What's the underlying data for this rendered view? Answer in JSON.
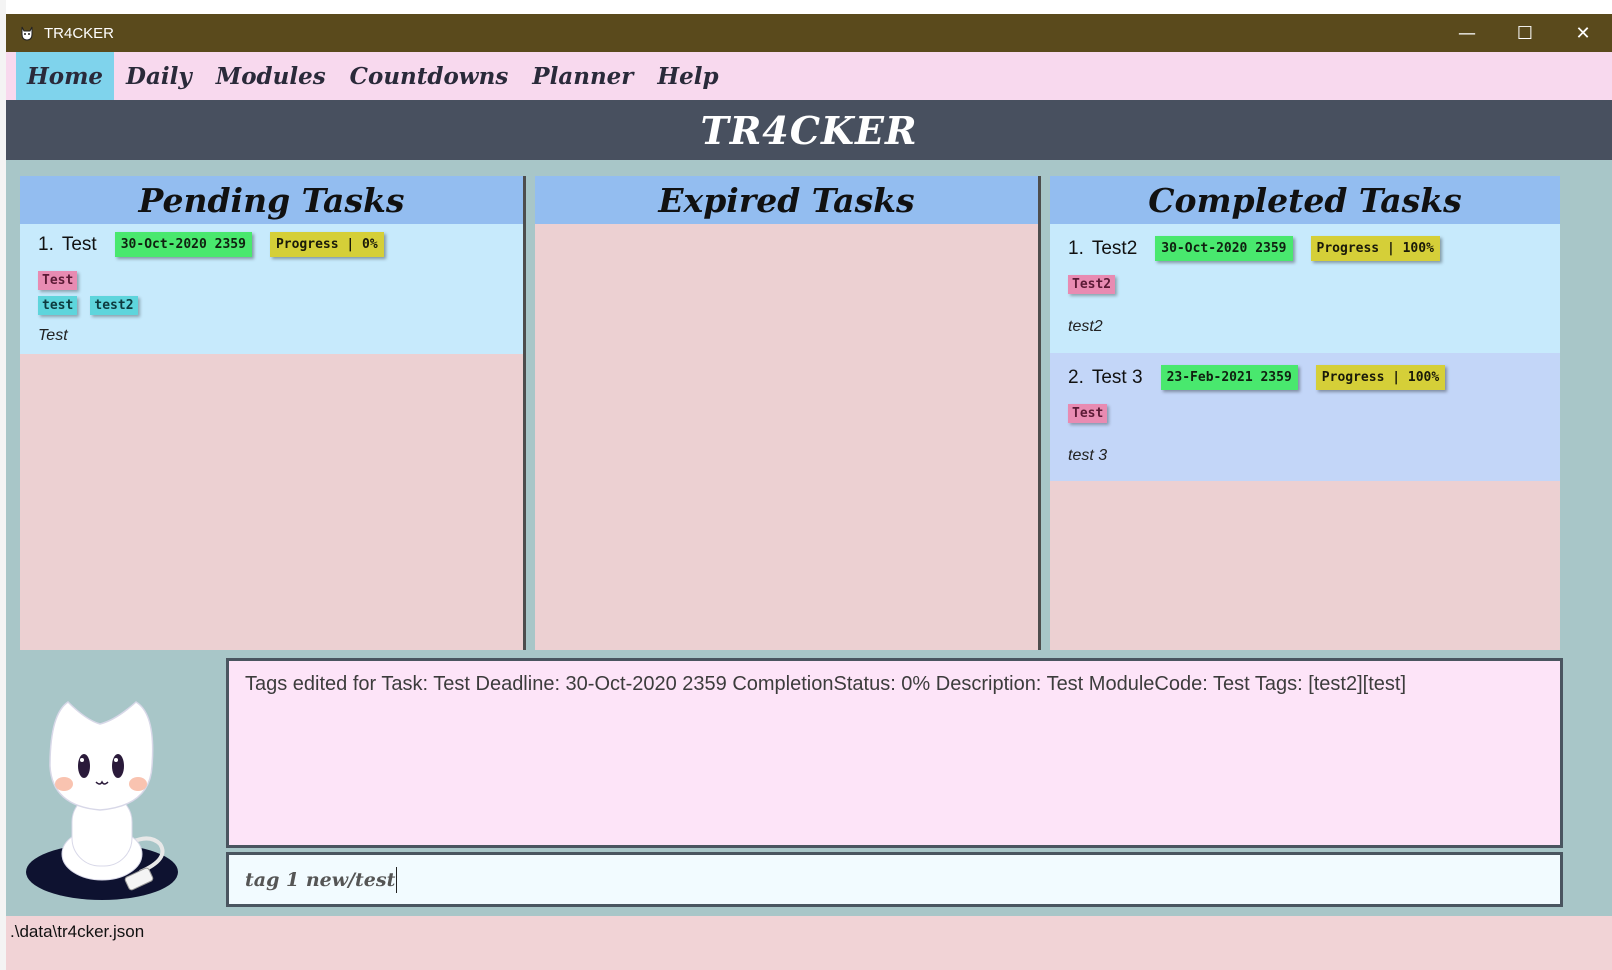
{
  "window": {
    "title": "TR4CKER",
    "controls": {
      "minimize": "—",
      "maximize": "☐",
      "close": "✕"
    }
  },
  "menu": {
    "items": [
      {
        "label": "Home",
        "active": true
      },
      {
        "label": "Daily",
        "active": false
      },
      {
        "label": "Modules",
        "active": false
      },
      {
        "label": "Countdowns",
        "active": false
      },
      {
        "label": "Planner",
        "active": false
      },
      {
        "label": "Help",
        "active": false
      }
    ]
  },
  "header": {
    "title": "TR4CKER"
  },
  "columns": {
    "pending": {
      "title": "Pending Tasks",
      "tasks": [
        {
          "index": "1.",
          "name": "Test",
          "deadline": "30-Oct-2020 2359",
          "progress": "Progress | 0%",
          "module_tag": "Test",
          "tags": [
            "test",
            "test2"
          ],
          "description": "Test"
        }
      ]
    },
    "expired": {
      "title": "Expired Tasks",
      "tasks": []
    },
    "completed": {
      "title": "Completed Tasks",
      "tasks": [
        {
          "index": "1.",
          "name": "Test2",
          "deadline": "30-Oct-2020 2359",
          "progress": "Progress | 100%",
          "module_tag": "Test2",
          "tags": [],
          "description": "test2"
        },
        {
          "index": "2.",
          "name": "Test 3",
          "deadline": "23-Feb-2021 2359",
          "progress": "Progress | 100%",
          "module_tag": "Test",
          "tags": [],
          "description": "test 3"
        }
      ]
    }
  },
  "result_display": {
    "text": "Tags edited for Task: Test Deadline: 30-Oct-2020 2359 CompletionStatus: 0% Description: Test ModuleCode: Test Tags: [test2][test]"
  },
  "command_box": {
    "value": "tag 1 new/test"
  },
  "status_bar": {
    "file_path": ".\\data\\tr4cker.json"
  },
  "colors": {
    "titlebar": "#5a4a1c",
    "menubar": "#f8d9ee",
    "active_menu": "#7fd3ec",
    "header": "#48505f",
    "column_header": "#93bdf0",
    "date_chip": "#49e86e",
    "progress_chip": "#d5cf38",
    "module_tag": "#e88bb2",
    "plain_tag": "#5ed5dc"
  }
}
